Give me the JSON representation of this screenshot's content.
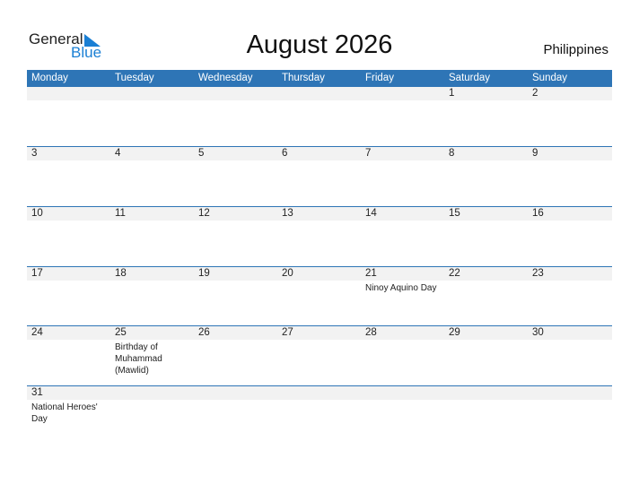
{
  "logo": {
    "general": "General",
    "blue": "Blue"
  },
  "title": "August 2026",
  "country": "Philippines",
  "colors": {
    "accent": "#2e75b6",
    "strip": "#f2f2f2"
  },
  "weekdays": [
    "Monday",
    "Tuesday",
    "Wednesday",
    "Thursday",
    "Friday",
    "Saturday",
    "Sunday"
  ],
  "weeks": [
    [
      {
        "d": ""
      },
      {
        "d": ""
      },
      {
        "d": ""
      },
      {
        "d": ""
      },
      {
        "d": ""
      },
      {
        "d": "1"
      },
      {
        "d": "2"
      }
    ],
    [
      {
        "d": "3"
      },
      {
        "d": "4"
      },
      {
        "d": "5"
      },
      {
        "d": "6"
      },
      {
        "d": "7"
      },
      {
        "d": "8"
      },
      {
        "d": "9"
      }
    ],
    [
      {
        "d": "10"
      },
      {
        "d": "11"
      },
      {
        "d": "12"
      },
      {
        "d": "13"
      },
      {
        "d": "14"
      },
      {
        "d": "15"
      },
      {
        "d": "16"
      }
    ],
    [
      {
        "d": "17"
      },
      {
        "d": "18"
      },
      {
        "d": "19"
      },
      {
        "d": "20"
      },
      {
        "d": "21",
        "note": "Ninoy Aquino Day"
      },
      {
        "d": "22"
      },
      {
        "d": "23"
      }
    ],
    [
      {
        "d": "24"
      },
      {
        "d": "25",
        "note": "Birthday of Muhammad (Mawlid)"
      },
      {
        "d": "26"
      },
      {
        "d": "27"
      },
      {
        "d": "28"
      },
      {
        "d": "29"
      },
      {
        "d": "30"
      }
    ],
    [
      {
        "d": "31",
        "note": "National Heroes' Day"
      },
      {
        "d": ""
      },
      {
        "d": ""
      },
      {
        "d": ""
      },
      {
        "d": ""
      },
      {
        "d": ""
      },
      {
        "d": ""
      }
    ]
  ]
}
